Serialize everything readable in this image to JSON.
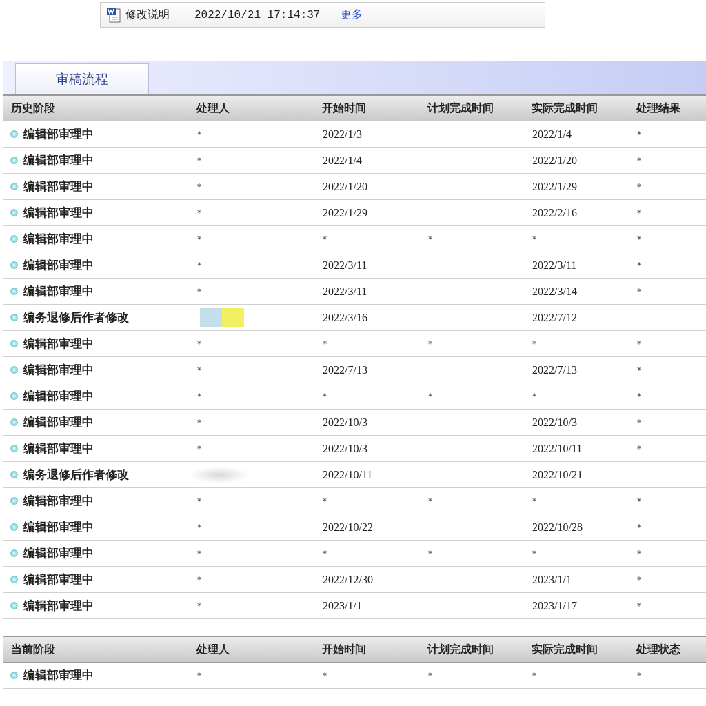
{
  "notice": {
    "label": "修改说明",
    "time": "2022/10/21 17:14:37",
    "more_link": "更多"
  },
  "tabs": [
    {
      "label": "审稿流程",
      "selected": true
    }
  ],
  "history": {
    "columns": [
      "历史阶段",
      "处理人",
      "开始时间",
      "计划完成时间",
      "实际完成时间",
      "处理结果"
    ],
    "rows": [
      {
        "kind": "plain",
        "stage": "编辑部审理中",
        "handler": "*",
        "start": "2022/1/3",
        "actual": "2022/1/4",
        "result": "*"
      },
      {
        "kind": "plain",
        "stage": "编辑部审理中",
        "handler": "*",
        "start": "2022/1/4",
        "actual": "2022/1/20",
        "result": "*"
      },
      {
        "kind": "plain",
        "stage": "编辑部审理中",
        "handler": "*",
        "start": "2022/1/20",
        "actual": "2022/1/29",
        "result": "*"
      },
      {
        "kind": "plain",
        "stage": "编辑部审理中",
        "handler": "*",
        "start": "2022/1/29",
        "actual": "2022/2/16",
        "result": "*"
      },
      {
        "kind": "plain",
        "stage": "编辑部审理中",
        "handler": "*",
        "start": "*",
        "planned": "*",
        "actual": "*",
        "result": "*"
      },
      {
        "kind": "plain",
        "stage": "编辑部审理中",
        "handler": "*",
        "start": "2022/3/11",
        "actual": "2022/3/11",
        "result": "*"
      },
      {
        "kind": "plain",
        "stage": "编辑部审理中",
        "handler": "*",
        "start": "2022/3/11",
        "actual": "2022/3/14",
        "result": "*"
      },
      {
        "kind": "colored",
        "stage": "编务退修后作者修改",
        "start": "2022/3/16",
        "actual": "2022/7/12"
      },
      {
        "kind": "plain",
        "stage": "编辑部审理中",
        "handler": "*",
        "start": "*",
        "planned": "*",
        "actual": "*",
        "result": "*"
      },
      {
        "kind": "plain",
        "stage": "编辑部审理中",
        "handler": "*",
        "start": "2022/7/13",
        "actual": "2022/7/13",
        "result": "*"
      },
      {
        "kind": "plain",
        "stage": "编辑部审理中",
        "handler": "*",
        "start": "*",
        "planned": "*",
        "actual": "*",
        "result": "*"
      },
      {
        "kind": "plain",
        "stage": "编辑部审理中",
        "handler": "*",
        "start": "2022/10/3",
        "actual": "2022/10/3",
        "result": "*"
      },
      {
        "kind": "plain",
        "stage": "编辑部审理中",
        "handler": "*",
        "start": "2022/10/3",
        "actual": "2022/10/11",
        "result": "*"
      },
      {
        "kind": "blurred",
        "stage": "编务退修后作者修改",
        "start": "2022/10/11",
        "actual": "2022/10/21"
      },
      {
        "kind": "plain",
        "stage": "编辑部审理中",
        "handler": "*",
        "start": "*",
        "planned": "*",
        "actual": "*",
        "result": "*"
      },
      {
        "kind": "plain",
        "stage": "编辑部审理中",
        "handler": "*",
        "start": "2022/10/22",
        "actual": "2022/10/28",
        "result": "*"
      },
      {
        "kind": "plain",
        "stage": "编辑部审理中",
        "handler": "*",
        "start": "*",
        "planned": "*",
        "actual": "*",
        "result": "*"
      },
      {
        "kind": "plain",
        "stage": "编辑部审理中",
        "handler": "*",
        "start": "2022/12/30",
        "actual": "2023/1/1",
        "result": "*"
      },
      {
        "kind": "plain",
        "stage": "编辑部审理中",
        "handler": "*",
        "start": "2023/1/1",
        "actual": "2023/1/17",
        "result": "*"
      }
    ]
  },
  "current": {
    "columns": [
      "当前阶段",
      "处理人",
      "开始时间",
      "计划完成时间",
      "实际完成时间",
      "处理状态"
    ],
    "rows": [
      {
        "kind": "plain",
        "stage": "编辑部审理中",
        "handler": "*",
        "start": "*",
        "planned": "*",
        "actual": "*",
        "result": "*"
      }
    ]
  }
}
